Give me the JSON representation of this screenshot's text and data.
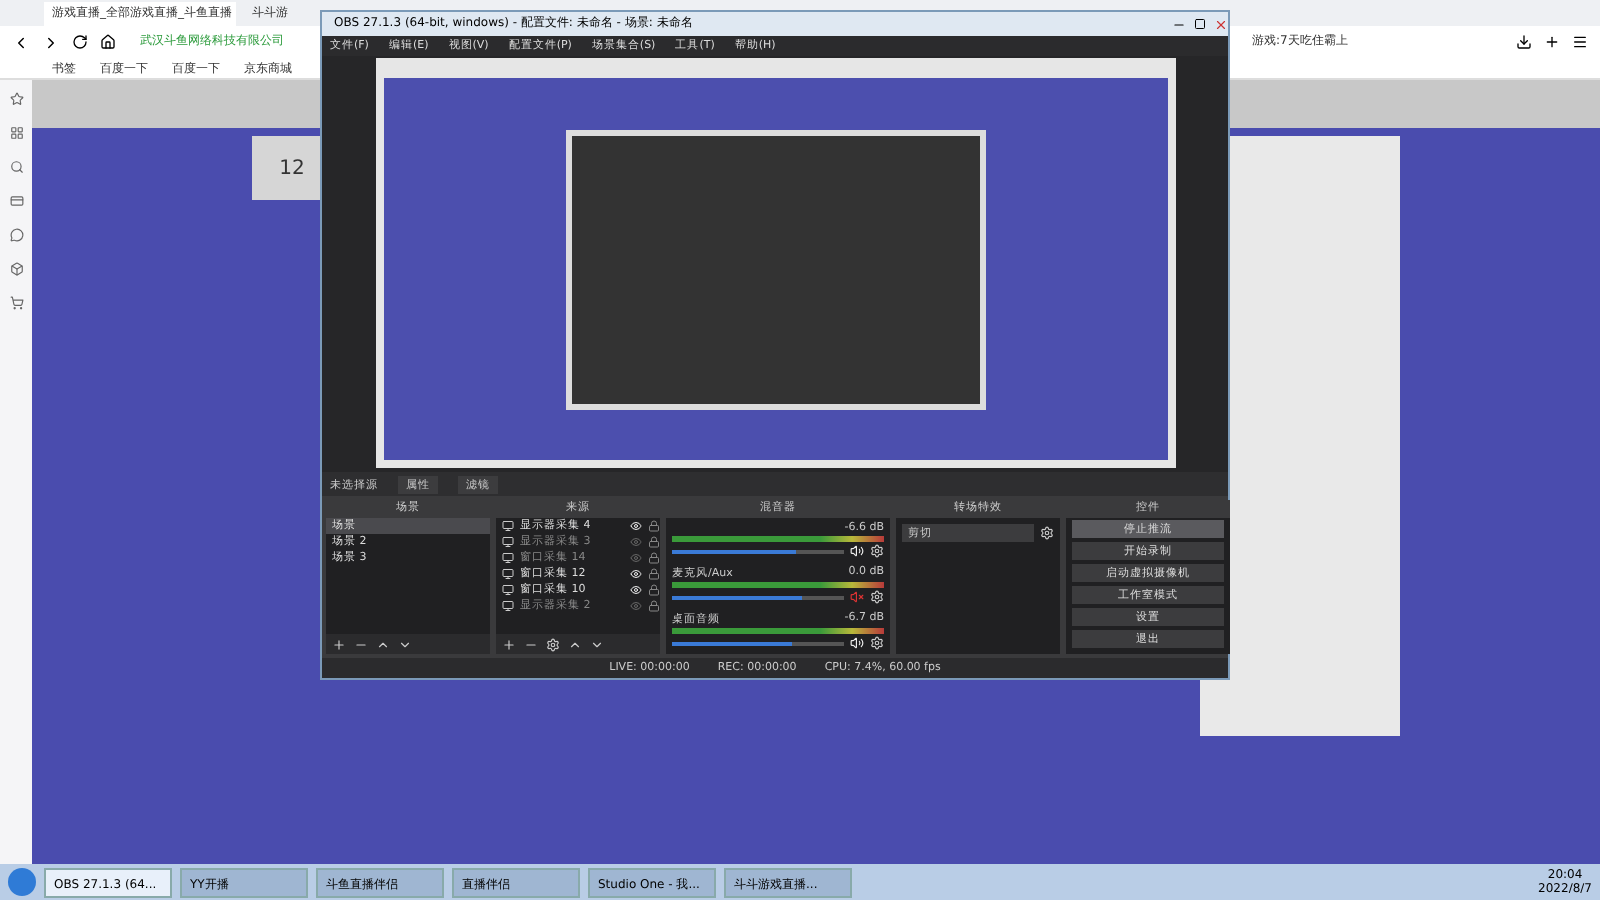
{
  "browser": {
    "tabs": [
      {
        "label": "游戏直播_全部游戏直播_斗鱼直播",
        "selected": true
      },
      {
        "label": "斗斗游",
        "selected": false
      }
    ],
    "address": "武汉斗鱼网络科技有限公司",
    "search": "游戏:7天吃住霸上",
    "bookmarks": [
      "书签",
      "百度一下",
      "百度一下",
      "京东商城"
    ]
  },
  "page": {
    "points": "12"
  },
  "obs": {
    "title": "OBS 27.1.3 (64-bit, windows) - 配置文件: 未命名 - 场景: 未命名",
    "menu": [
      "文件(F)",
      "编辑(E)",
      "视图(V)",
      "配置文件(P)",
      "场景集合(S)",
      "工具(T)",
      "帮助(H)"
    ],
    "source_label": "未选择源",
    "source_buttons": [
      "属性",
      "滤镜"
    ],
    "docks": [
      "场景",
      "来源",
      "混音器",
      "转场特效",
      "控件"
    ],
    "scenes": [
      {
        "label": "场景",
        "selected": true
      },
      {
        "label": "场景 2",
        "selected": false
      },
      {
        "label": "场景 3",
        "selected": false
      }
    ],
    "sources": [
      {
        "label": "显示器采集 4",
        "visible": true
      },
      {
        "label": "显示器采集 3",
        "visible": false
      },
      {
        "label": "窗口采集 14",
        "visible": false
      },
      {
        "label": "窗口采集 12",
        "visible": true
      },
      {
        "label": "窗口采集 10",
        "visible": true
      },
      {
        "label": "显示器采集 2",
        "visible": false
      }
    ],
    "mixer": [
      {
        "reading": "-6.6 dB",
        "level": 0.72,
        "muted": false
      },
      {
        "name": "麦克风/Aux",
        "reading": "0.0 dB",
        "level": 0.75,
        "muted": true
      },
      {
        "name": "桌面音频",
        "reading": "-6.7 dB",
        "level": 0.7,
        "muted": false
      }
    ],
    "transition": "剪切",
    "controls": [
      {
        "label": "停止推流",
        "selected": true
      },
      {
        "label": "开始录制",
        "selected": false
      },
      {
        "label": "启动虚拟摄像机",
        "selected": false
      },
      {
        "label": "工作室模式",
        "selected": false
      },
      {
        "label": "设置",
        "selected": false
      },
      {
        "label": "退出",
        "selected": false
      }
    ],
    "status": [
      "LIVE: 00:00:00",
      "REC: 00:00:00",
      "CPU: 7.4%, 60.00 fps"
    ]
  },
  "taskbar": {
    "items": [
      {
        "label": "OBS 27.1.3 (64...",
        "selected": true
      },
      {
        "label": "YY开播",
        "selected": false
      },
      {
        "label": "斗鱼直播伴侣",
        "selected": false
      },
      {
        "label": "直播伴侣",
        "selected": false
      },
      {
        "label": "Studio One - 我...",
        "selected": false
      },
      {
        "label": "斗斗游戏直播...",
        "selected": false
      }
    ],
    "time": "20:04",
    "date": "2022/8/7"
  }
}
